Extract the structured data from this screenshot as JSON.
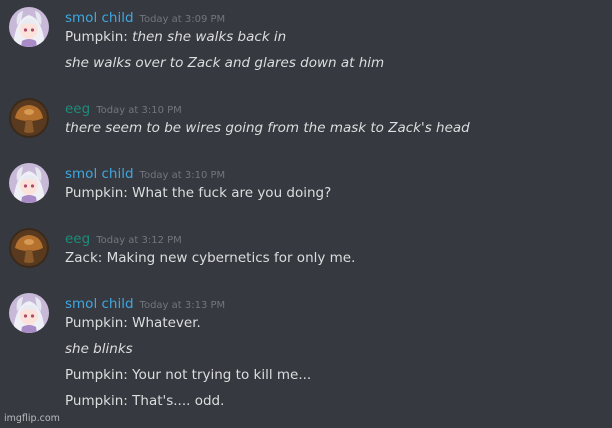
{
  "watermark": "imgflip.com",
  "groups": [
    {
      "user": "smol child",
      "user_color": "#3fa7e0",
      "avatar": "anime-girl-avatar",
      "timestamp": "Today at 3:09 PM",
      "messages": [
        {
          "prefix": "Pumpkin: ",
          "text": "then she walks back in"
        },
        {
          "text": "she walks over to Zack and glares down at him"
        }
      ]
    },
    {
      "user": "eeg",
      "user_color": "#1f8b7a",
      "avatar": "mushroom-avatar",
      "timestamp": "Today at 3:10 PM",
      "messages": [
        {
          "text": "there seem to be wires going from the mask to Zack's head"
        }
      ]
    },
    {
      "user": "smol child",
      "user_color": "#3fa7e0",
      "avatar": "anime-girl-avatar",
      "timestamp": "Today at 3:10 PM",
      "messages": [
        {
          "text": "Pumpkin: What the fuck are you doing?"
        }
      ]
    },
    {
      "user": "eeg",
      "user_color": "#1f8b7a",
      "avatar": "mushroom-avatar",
      "timestamp": "Today at 3:12 PM",
      "messages": [
        {
          "text": "Zack: Making new cybernetics for only me."
        }
      ]
    },
    {
      "user": "smol child",
      "user_color": "#3fa7e0",
      "avatar": "anime-girl-avatar",
      "timestamp": "Today at 3:13 PM",
      "messages": [
        {
          "text": "Pumpkin: Whatever."
        },
        {
          "text": "she blinks"
        },
        {
          "text": "Pumpkin: Your not trying to kill me..."
        },
        {
          "text": "Pumpkin: That's.... odd."
        }
      ]
    }
  ]
}
